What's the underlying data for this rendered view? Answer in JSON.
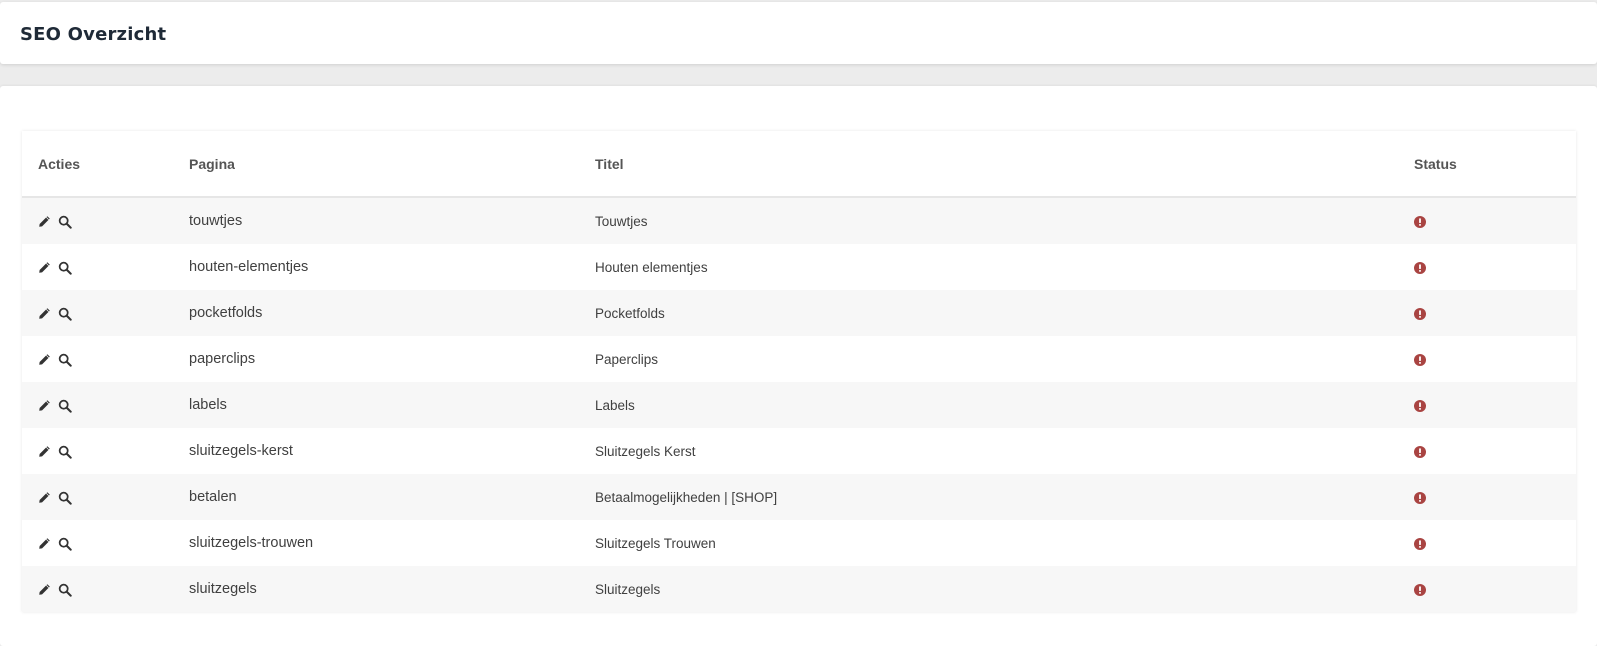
{
  "header": {
    "title": "SEO Overzicht"
  },
  "table": {
    "columns": {
      "actions": "Acties",
      "page": "Pagina",
      "title": "Titel",
      "status": "Status"
    },
    "rows": [
      {
        "page": "touwtjes",
        "title": "Touwtjes",
        "status": "error"
      },
      {
        "page": "houten-elementjes",
        "title": "Houten elementjes",
        "status": "error"
      },
      {
        "page": "pocketfolds",
        "title": "Pocketfolds",
        "status": "error"
      },
      {
        "page": "paperclips",
        "title": "Paperclips",
        "status": "error"
      },
      {
        "page": "labels",
        "title": "Labels",
        "status": "error"
      },
      {
        "page": "sluitzegels-kerst",
        "title": "Sluitzegels Kerst",
        "status": "error"
      },
      {
        "page": "betalen",
        "title": "Betaalmogelijkheden | [SHOP]",
        "status": "error"
      },
      {
        "page": "sluitzegels-trouwen",
        "title": "Sluitzegels Trouwen",
        "status": "error"
      },
      {
        "page": "sluitzegels",
        "title": "Sluitzegels",
        "status": "error"
      }
    ],
    "action_icons": [
      "pencil-icon",
      "search-icon"
    ],
    "status_icon": "exclamation-circle-icon",
    "status_color": "#a94442"
  }
}
